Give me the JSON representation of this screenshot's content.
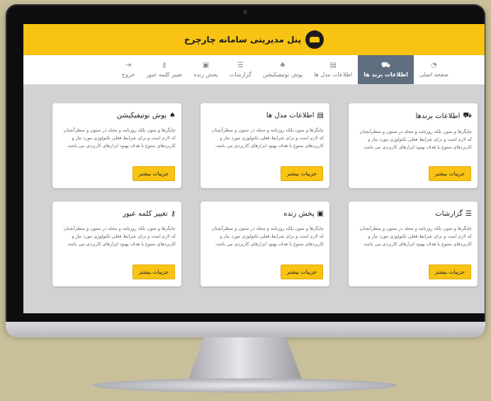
{
  "header": {
    "title": "پنل مدیریتی سامانه چارچرخ"
  },
  "nav": [
    {
      "label": "صفحه اصلی",
      "icon": "dashboard-icon",
      "glyph": "◔",
      "active": false
    },
    {
      "label": "اطلاعات برند ها",
      "icon": "truck-icon",
      "glyph": "⛟",
      "active": true
    },
    {
      "label": "اطلاعات مدل ها",
      "icon": "car-icon",
      "glyph": "▤",
      "active": false
    },
    {
      "label": "پوش نوتیفیکیشن",
      "icon": "bell-icon",
      "glyph": "♠",
      "active": false
    },
    {
      "label": "گزارشات",
      "icon": "list-icon",
      "glyph": "☰",
      "active": false
    },
    {
      "label": "پخش زنده",
      "icon": "video-icon",
      "glyph": "▣",
      "active": false
    },
    {
      "label": "تغییر کلمه عبور",
      "icon": "key-icon",
      "glyph": "⚷",
      "active": false
    },
    {
      "label": "خروج",
      "icon": "logout-icon",
      "glyph": "⇥",
      "active": false
    }
  ],
  "cards": [
    {
      "title": "اطلاعات برندها",
      "icon": "truck-icon",
      "glyph": "⛟",
      "text": "چاپگرها و متون بلکه روزنامه و مجله در ستون و سطرآنچنان که لازم است و برای شرایط فعلی تکنولوژی مورد نیاز و کاربردهای متنوع با هدف بهبود ابزارهای کاربردی می باشد.",
      "button": "جزییات بیشتر"
    },
    {
      "title": "اطلاعات مدل ها",
      "icon": "car-icon",
      "glyph": "▤",
      "text": "چاپگرها و متون بلکه روزنامه و مجله در ستون و سطرآنچنان که لازم است و برای شرایط فعلی تکنولوژی مورد نیاز و کاربردهای متنوع با هدف بهبود ابزارهای کاربردی می باشد.",
      "button": "جزییات بیشتر"
    },
    {
      "title": "پوش نوتیفیکیشن",
      "icon": "bell-icon",
      "glyph": "♠",
      "text": "چاپگرها و متون بلکه روزنامه و مجله در ستون و سطرآنچنان که لازم است و برای شرایط فعلی تکنولوژی مورد نیاز و کاربردهای متنوع با هدف بهبود ابزارهای کاربردی می باشد.",
      "button": "جزییات بیشتر"
    },
    {
      "title": "گزارشات",
      "icon": "list-icon",
      "glyph": "☰",
      "text": "چاپگرها و متون بلکه روزنامه و مجله در ستون و سطرآنچنان که لازم است و برای شرایط فعلی تکنولوژی مورد نیاز و کاربردهای متنوع با هدف بهبود ابزارهای کاربردی می باشد.",
      "button": "جزییات بیشتر"
    },
    {
      "title": "پخش زنده",
      "icon": "video-icon",
      "glyph": "▣",
      "text": "چاپگرها و متون بلکه روزنامه و مجله در ستون و سطرآنچنان که لازم است و برای شرایط فعلی تکنولوژی مورد نیاز و کاربردهای متنوع با هدف بهبود ابزارهای کاربردی می باشد.",
      "button": "جزییات بیشتر"
    },
    {
      "title": "تغییر کلمه عبور",
      "icon": "key-icon",
      "glyph": "⚷",
      "text": "چاپگرها و متون بلکه روزنامه و مجله در ستون و سطرآنچنان که لازم است و برای شرایط فعلی تکنولوژی مورد نیاز و کاربردهای متنوع با هدف بهبود ابزارهای کاربردی می باشد.",
      "button": "جزییات بیشتر"
    }
  ],
  "colors": {
    "accent": "#f8c313",
    "active_tab": "#5f6f7f",
    "content_bg": "#d2d2d2"
  }
}
